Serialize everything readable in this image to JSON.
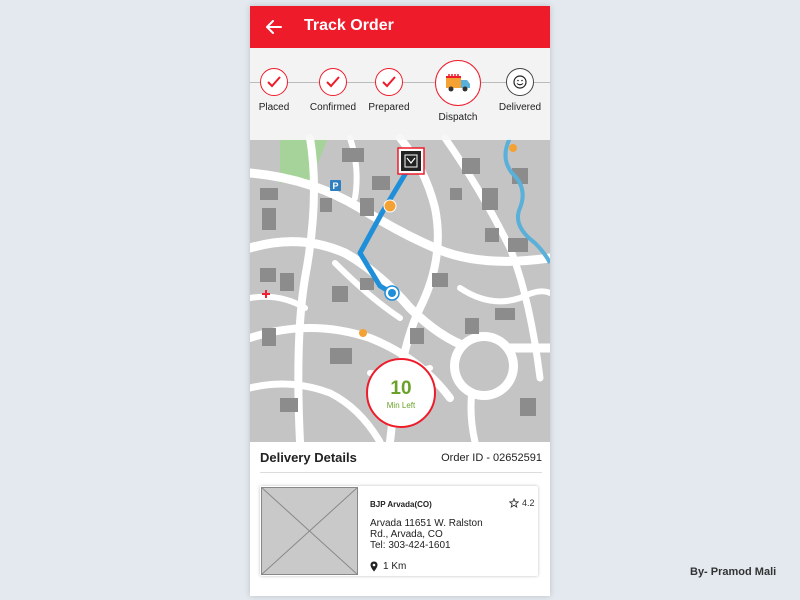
{
  "header": {
    "title": "Track Order",
    "back_icon": "arrow-left-icon"
  },
  "steps": [
    {
      "label": "Placed",
      "state": "done",
      "icon": "check-icon"
    },
    {
      "label": "Confirmed",
      "state": "done",
      "icon": "check-icon"
    },
    {
      "label": "Prepared",
      "state": "done",
      "icon": "check-icon"
    },
    {
      "label": "Dispatch",
      "state": "current",
      "icon": "delivery-truck-icon"
    },
    {
      "label": "Delivered",
      "state": "pending",
      "icon": "smiley-icon"
    }
  ],
  "map": {
    "restaurant_marker": "restaurant-logo-icon",
    "parking_label": "P"
  },
  "eta": {
    "value": "10",
    "unit": "Min Left"
  },
  "details": {
    "title": "Delivery Details",
    "order_id": "Order ID - 02652591"
  },
  "store": {
    "name": "BJP Arvada(CO)",
    "rating": "4.2",
    "address_line1": "Arvada 11651 W. Ralston",
    "address_line2": "Rd., Arvada, CO",
    "phone": "Tel: 303-424-1601",
    "distance": "1 Km"
  },
  "credit": "By- Pramod Mali",
  "colors": {
    "accent": "#ee1c2b",
    "eta_green": "#6aa12a",
    "route_blue": "#1e8fd8",
    "water": "#5ab0d8"
  }
}
